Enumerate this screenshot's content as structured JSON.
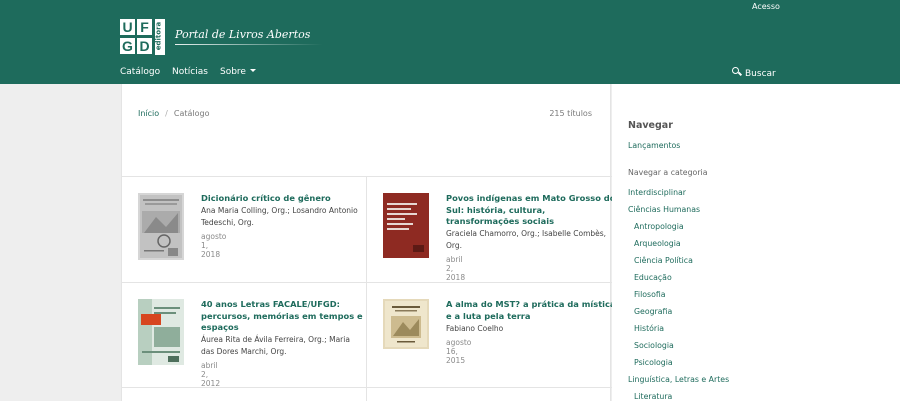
{
  "header": {
    "acesso": "Acesso",
    "logo": {
      "l1": "U",
      "l2": "F",
      "l3": "G",
      "l4": "D",
      "editora": "editora"
    },
    "portal_title": "Portal de Livros Abertos",
    "nav": {
      "catalogo": "Catálogo",
      "noticias": "Notícias",
      "sobre": "Sobre"
    },
    "search_label": "Buscar"
  },
  "colors": {
    "brand": "#1e6b5c",
    "accent": "#d7461f"
  },
  "breadcrumb": {
    "home": "Início",
    "separator": "/",
    "current": "Catálogo"
  },
  "count": "215 títulos",
  "books": [
    {
      "title_lines": [
        "Dicionário crítico de gênero"
      ],
      "author_lines": [
        "Ana Maria Colling, Org.; Losandro Antonio",
        "Tedeschi, Org."
      ],
      "date": "agosto 1, 2018"
    },
    {
      "title_lines": [
        "Povos indígenas em Mato Grosso do",
        "Sul: história, cultura,",
        "transformações sociais"
      ],
      "author_lines": [
        "Graciela Chamorro, Org.; Isabelle Combès,",
        "Org."
      ],
      "date": "abril 2, 2018"
    },
    {
      "title_lines": [
        "40 anos Letras FACALE/UFGD:",
        "percursos, memórias em tempos e",
        "espaços"
      ],
      "author_lines": [
        "Áurea Rita de Ávila Ferreira, Org.; Maria",
        "das Dores Marchi, Org."
      ],
      "date": "abril 2, 2012"
    },
    {
      "title_lines": [
        "A alma do MST? a prática da mística",
        "e a luta pela terra"
      ],
      "author_lines": [
        "Fabiano Coelho"
      ],
      "date": "agosto 16, 2015"
    }
  ],
  "sidebar": {
    "heading": "Navegar",
    "lancamentos": "Lançamentos",
    "navegar_categoria": "Navegar a categoria",
    "categories": [
      "Interdisciplinar",
      "Ciências Humanas"
    ],
    "subcategories": [
      "Antropologia",
      "Arqueologia",
      "Ciência Política",
      "Educação",
      "Filosofia",
      "Geografia",
      "História",
      "Sociologia",
      "Psicologia"
    ],
    "categories2": [
      "Linguística, Letras e Artes"
    ],
    "subcategories2": [
      "Literatura"
    ]
  }
}
